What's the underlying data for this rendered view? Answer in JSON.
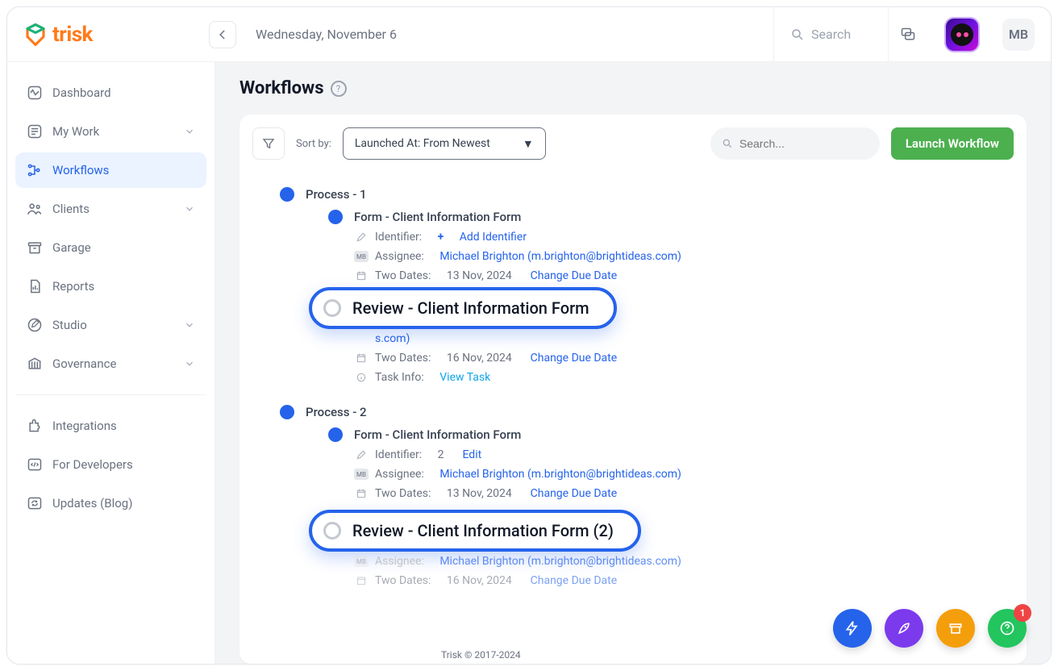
{
  "brand": {
    "name": "trisk",
    "accent": "#ff7a1a"
  },
  "topbar": {
    "date": "Wednesday, November 6",
    "search_label": "Search",
    "user_initials": "MB"
  },
  "sidebar": {
    "items": [
      {
        "id": "dashboard",
        "label": "Dashboard",
        "expandable": false
      },
      {
        "id": "my-work",
        "label": "My Work",
        "expandable": true
      },
      {
        "id": "workflows",
        "label": "Workflows",
        "expandable": false,
        "active": true
      },
      {
        "id": "clients",
        "label": "Clients",
        "expandable": true
      },
      {
        "id": "garage",
        "label": "Garage",
        "expandable": false
      },
      {
        "id": "reports",
        "label": "Reports",
        "expandable": false
      },
      {
        "id": "studio",
        "label": "Studio",
        "expandable": true
      },
      {
        "id": "governance",
        "label": "Governance",
        "expandable": true
      }
    ],
    "lower": [
      {
        "id": "integrations",
        "label": "Integrations"
      },
      {
        "id": "developers",
        "label": "For Developers"
      },
      {
        "id": "updates",
        "label": "Updates (Blog)"
      }
    ]
  },
  "page": {
    "title": "Workflows"
  },
  "toolbar": {
    "sort_label": "Sort by:",
    "sort_value": "Launched At: From Newest",
    "search_placeholder": "Search...",
    "launch_label": "Launch Workflow"
  },
  "labels": {
    "identifier": "Identifier:",
    "add_identifier": "Add Identifier",
    "edit": "Edit",
    "assignee": "Assignee:",
    "two_dates": "Two Dates:",
    "change_due": "Change Due Date",
    "task_info": "Task Info:",
    "view_task": "View Task",
    "mb": "MB"
  },
  "processes": [
    {
      "title": "Process - 1",
      "form": {
        "title": "Form - Client Information Form",
        "identifier_value": null,
        "assignee": "Michael Brighton (m.brighton@brightideas.com)",
        "date": "13 Nov, 2024"
      },
      "review": {
        "title": "Review - Client Information Form",
        "partial_assignee_suffix": "s.com)",
        "date": "16 Nov, 2024"
      }
    },
    {
      "title": "Process - 2",
      "form": {
        "title": "Form - Client Information Form",
        "identifier_value": "2",
        "assignee": "Michael Brighton (m.brighton@brightideas.com)",
        "date": "13 Nov, 2024"
      },
      "review": {
        "title": "Review - Client Information Form (2)",
        "partial_assignee": "Michael Brighton (m.brighton@brightideas.com)",
        "partial_assignee_label": "Assignee:",
        "date": "16 Nov, 2024"
      }
    }
  ],
  "footer": "Trisk © 2017-2024",
  "notifications": "1"
}
